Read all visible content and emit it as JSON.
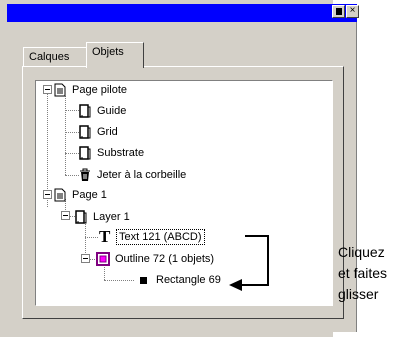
{
  "window": {
    "minimize_glyph": "",
    "close_glyph": "×"
  },
  "tabs": [
    {
      "label": "Calques",
      "active": false
    },
    {
      "label": "Objets",
      "active": true
    }
  ],
  "tree": {
    "nodes": [
      {
        "label": "Page pilote",
        "icon": "page-icon"
      },
      {
        "label": "Guide",
        "icon": "layer-icon"
      },
      {
        "label": "Grid",
        "icon": "layer-icon"
      },
      {
        "label": "Substrate",
        "icon": "layer-icon"
      },
      {
        "label": "Jeter à la corbeille",
        "icon": "trash-icon"
      },
      {
        "label": "Page 1",
        "icon": "page-icon"
      },
      {
        "label": "Layer 1",
        "icon": "layer-icon"
      },
      {
        "label": "Text 121 (ABCD)",
        "icon": "text-icon"
      },
      {
        "label": "Outline 72 (1 objets)",
        "icon": "group-icon"
      },
      {
        "label": "Rectangle 69",
        "icon": "rectangle-icon"
      }
    ]
  },
  "callout": {
    "lines": [
      "Cliquez",
      "et faites",
      "glisser"
    ]
  }
}
